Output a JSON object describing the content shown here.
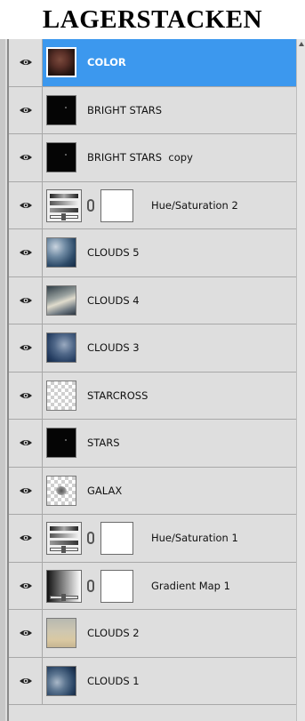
{
  "heading": "LAGERSTACKEN",
  "layers": [
    {
      "name": "COLOR",
      "kind": "image",
      "thumb": "t-color",
      "selected": true,
      "visible": true
    },
    {
      "name": "BRIGHT STARS",
      "kind": "image",
      "thumb": "t-dark",
      "visible": true
    },
    {
      "name": "BRIGHT STARS  copy",
      "kind": "image",
      "thumb": "t-dark",
      "visible": true
    },
    {
      "name": "Hue/Saturation 2",
      "kind": "adjustment-hue",
      "visible": true
    },
    {
      "name": "CLOUDS 5",
      "kind": "image",
      "thumb": "t-clouds5",
      "visible": true
    },
    {
      "name": "CLOUDS 4",
      "kind": "image",
      "thumb": "t-clouds4",
      "visible": true
    },
    {
      "name": "CLOUDS 3",
      "kind": "image",
      "thumb": "t-clouds3",
      "visible": true
    },
    {
      "name": "STARCROSS",
      "kind": "image",
      "thumb": "t-check",
      "visible": true
    },
    {
      "name": "STARS",
      "kind": "image",
      "thumb": "t-dark",
      "visible": true
    },
    {
      "name": "GALAX",
      "kind": "image",
      "thumb": "t-galax",
      "visible": true
    },
    {
      "name": "Hue/Saturation 1",
      "kind": "adjustment-hue",
      "visible": true
    },
    {
      "name": "Gradient Map 1",
      "kind": "adjustment-gradient",
      "visible": true
    },
    {
      "name": "CLOUDS 2",
      "kind": "image",
      "thumb": "t-clouds2",
      "visible": true
    },
    {
      "name": "CLOUDS 1",
      "kind": "image",
      "thumb": "t-clouds1",
      "visible": true
    }
  ],
  "colors": {
    "selection": "#3c98ee",
    "panel": "#dedede"
  },
  "icons": {
    "visibility": "eye-icon",
    "link": "chain-link-icon"
  }
}
